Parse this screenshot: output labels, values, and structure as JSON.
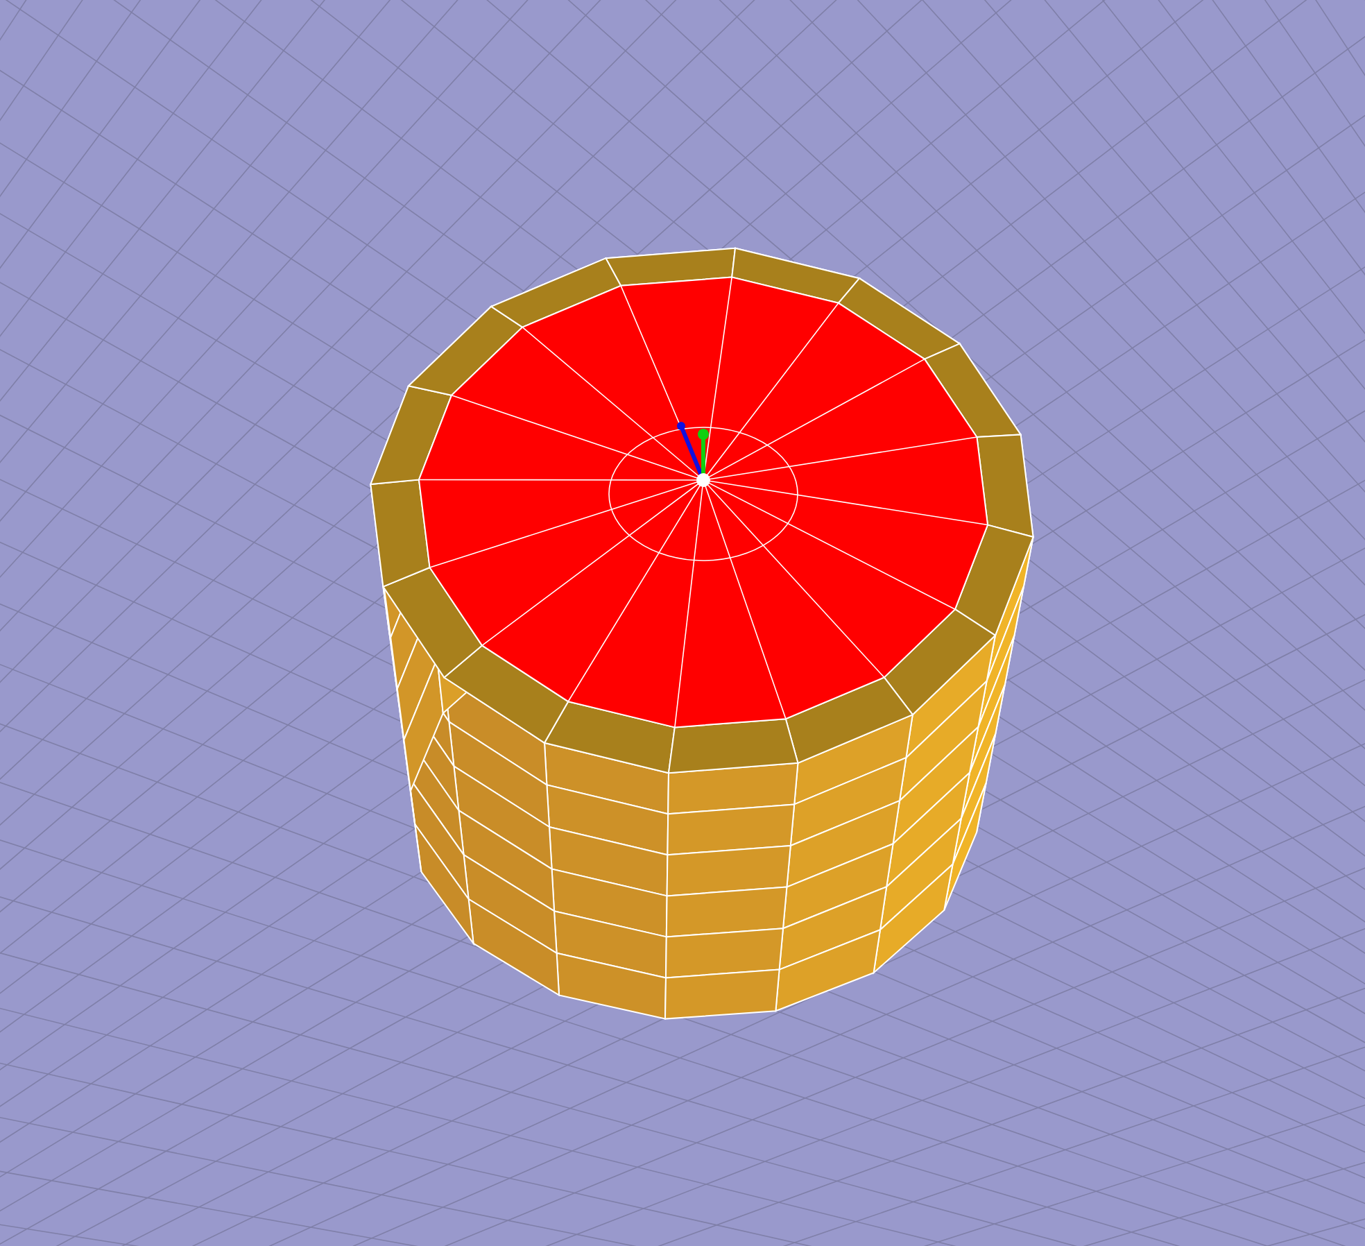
{
  "viewport": {
    "top_face_selected": true,
    "grid_visible": true,
    "gizmo_visible": true
  }
}
